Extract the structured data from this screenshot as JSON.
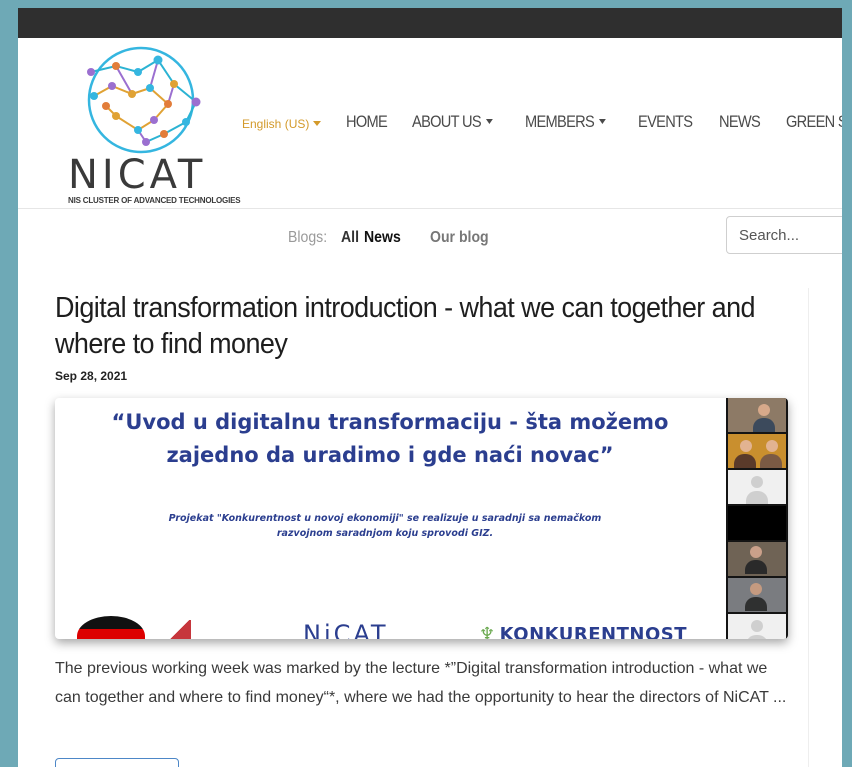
{
  "header": {
    "language": "English (US)",
    "nav": [
      "HOME",
      "ABOUT US",
      "MEMBERS",
      "EVENTS",
      "NEWS",
      "GREEN STARTUP ACADEM"
    ],
    "logo_text": "NICAT",
    "logo_subtitle": "NIS CLUSTER OF ADVANCED TECHNOLOGIES"
  },
  "blogs": {
    "label": "Blogs:",
    "items": [
      "All",
      "News",
      "Our blog"
    ]
  },
  "search": {
    "placeholder": "Search..."
  },
  "post": {
    "title": "Digital transformation introduction - what we can together and where to find money",
    "date": "Sep 28, 2021",
    "image": {
      "slide_title_line1": "“Uvod u digitalnu transformaciju - šta možemo",
      "slide_title_line2": "zajedno da uradimo i gde naći novac”",
      "slide_note_line1": "Projekat \"Konkurentnost u novoj ekonomiji\" se realizuje u saradnji sa nemačkom",
      "slide_note_line2": "razvojnom saradnjom koju sprovodi GIZ.",
      "bottom_logo_1": "NiCAT",
      "bottom_logo_2": "KONKURENTNOST"
    },
    "excerpt": "The previous working week was marked by the lecture *”Digital transformation introduction - what we can together and where to find money“*, where we had the opportunity to hear the directors of NiCAT ..."
  },
  "colors": {
    "background": "#6ea9b6",
    "topbar": "#2f2f2f",
    "language_accent": "#d39a2b",
    "slide_text": "#2b3e8f"
  }
}
